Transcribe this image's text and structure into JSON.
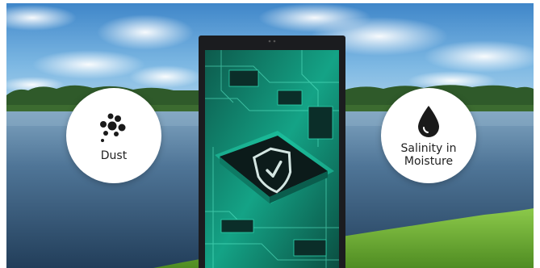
{
  "scene": {
    "description_icons": [
      "cloud-sky",
      "treeline",
      "lake",
      "grass-hill"
    ]
  },
  "badges": {
    "dust": {
      "label": "Dust",
      "icon": "dust-particles-icon"
    },
    "salinity": {
      "label": "Salinity in\nMoisture",
      "icon": "water-drop-icon"
    }
  },
  "display": {
    "screen_icon": "shield-check-icon",
    "colors": {
      "circuit": "#1fd1a8",
      "bezel": "#1b1c1f",
      "sky": "#5ea4d8",
      "lake": "#2a4a66"
    }
  }
}
